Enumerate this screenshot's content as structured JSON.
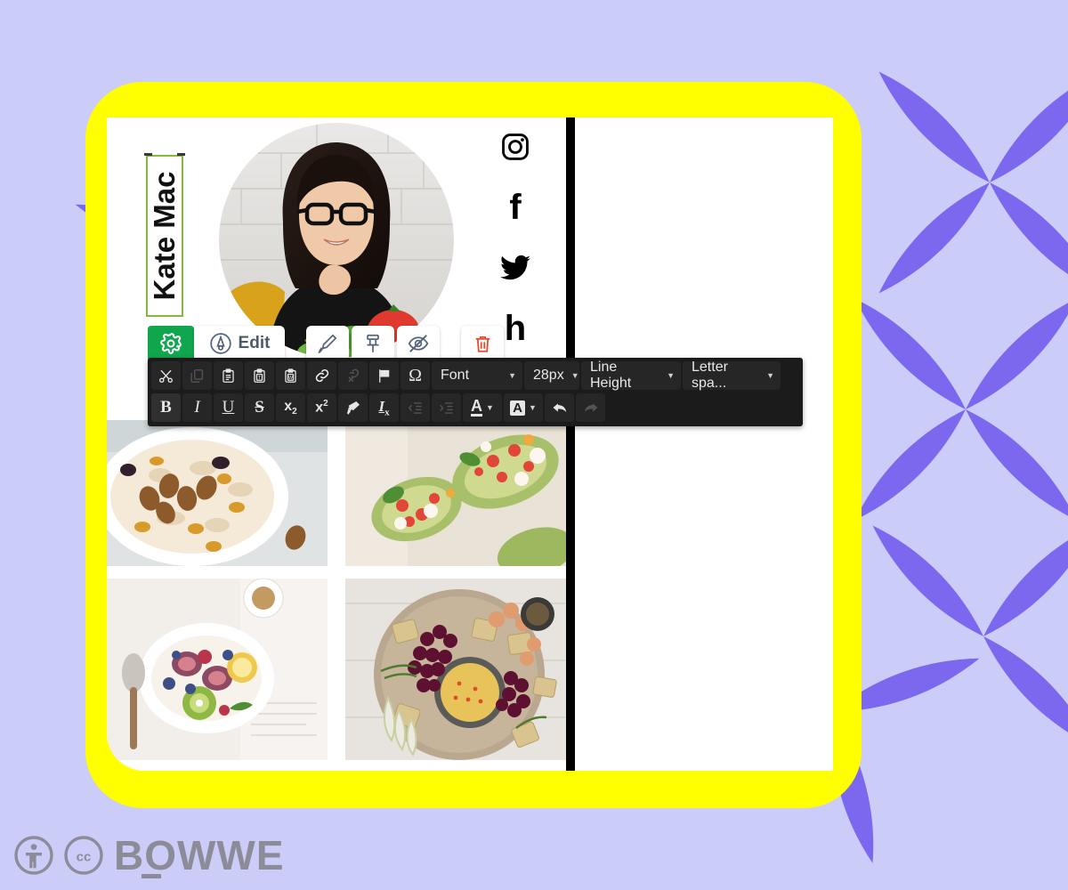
{
  "theme": {
    "page_bg": "#ccccf9",
    "petal_color": "#7b68ee",
    "frame_color": "#ffff00",
    "card_color": "#ffffff",
    "accent_green": "#10a64e",
    "selection_green": "#86b93a",
    "divider_black": "#000000",
    "toolbar_bg": "#1b1b1b",
    "delete_red": "#e8472c"
  },
  "site_preview": {
    "name_block": {
      "text": "Kate Mac",
      "orientation": "vertical-rotated",
      "selected": true
    },
    "portrait": {
      "alt": "woman-with-glasses-in-kitchen-portrait"
    },
    "socials": [
      {
        "name": "instagram",
        "glyph": "instagram-icon"
      },
      {
        "name": "facebook",
        "glyph": "f"
      },
      {
        "name": "twitter",
        "glyph": "twitter-bird-icon"
      },
      {
        "name": "houzz",
        "glyph": "h"
      }
    ],
    "gallery": [
      {
        "alt": "oatmeal-bowl-with-nuts-and-raisins"
      },
      {
        "alt": "stuffed-avocado-halves-with-tomato-and-feta"
      },
      {
        "alt": "yogurt-bowl-with-figs-kiwi-and-berries"
      },
      {
        "alt": "charcuterie-board-with-grapes-and-crackers"
      }
    ]
  },
  "control_bar": {
    "buttons": [
      {
        "name": "settings-gear-button",
        "icon": "gear-icon",
        "label": ""
      },
      {
        "name": "edit-button",
        "icon": "pen-circle-icon",
        "label": "Edit"
      },
      {
        "name": "style-brush-button",
        "icon": "paintbrush-icon",
        "label": ""
      },
      {
        "name": "pin-button",
        "icon": "pin-icon",
        "label": ""
      },
      {
        "name": "hide-button",
        "icon": "eye-off-icon",
        "label": ""
      },
      {
        "name": "delete-button",
        "icon": "trash-icon",
        "label": ""
      }
    ]
  },
  "rte_toolbar": {
    "row1": [
      {
        "name": "cut-button",
        "icon": "scissors-icon",
        "state": "enabled"
      },
      {
        "name": "copy-button",
        "icon": "copy-icon",
        "state": "disabled"
      },
      {
        "name": "paste-button",
        "icon": "clipboard-icon",
        "state": "enabled"
      },
      {
        "name": "paste-as-text-button",
        "icon": "clipboard-text-icon",
        "state": "enabled"
      },
      {
        "name": "paste-from-word-button",
        "icon": "clipboard-word-icon",
        "state": "enabled"
      },
      {
        "name": "insert-link-button",
        "icon": "link-icon",
        "state": "enabled"
      },
      {
        "name": "unlink-button",
        "icon": "unlink-icon",
        "state": "disabled"
      },
      {
        "name": "anchor-flag-button",
        "icon": "flag-icon",
        "state": "enabled"
      },
      {
        "name": "special-character-button",
        "icon": "omega-icon",
        "state": "enabled"
      }
    ],
    "dropdowns": [
      {
        "name": "font-family-select",
        "value": "Font"
      },
      {
        "name": "font-size-select",
        "value": "28px"
      },
      {
        "name": "line-height-select",
        "value": "Line Height"
      },
      {
        "name": "letter-spacing-select",
        "value": "Letter spa..."
      }
    ],
    "row2": [
      {
        "name": "bold-button",
        "icon": "bold-icon",
        "glyph": "B",
        "state": "active"
      },
      {
        "name": "italic-button",
        "icon": "italic-icon",
        "glyph": "I",
        "state": "enabled"
      },
      {
        "name": "underline-button",
        "icon": "underline-icon",
        "glyph": "U",
        "state": "enabled"
      },
      {
        "name": "strikethrough-button",
        "icon": "strikethrough-icon",
        "glyph": "S",
        "state": "enabled"
      },
      {
        "name": "subscript-button",
        "icon": "subscript-icon",
        "glyph": "x",
        "state": "enabled"
      },
      {
        "name": "superscript-button",
        "icon": "superscript-icon",
        "glyph": "x",
        "state": "enabled"
      },
      {
        "name": "copy-formatting-button",
        "icon": "paintbrush-icon",
        "state": "enabled"
      },
      {
        "name": "remove-format-button",
        "icon": "remove-format-icon",
        "glyph": "I",
        "state": "enabled"
      },
      {
        "name": "decrease-indent-button",
        "icon": "outdent-icon",
        "state": "disabled"
      },
      {
        "name": "increase-indent-button",
        "icon": "indent-icon",
        "state": "disabled"
      },
      {
        "name": "text-color-button",
        "icon": "text-color-icon",
        "glyph": "A",
        "state": "enabled"
      },
      {
        "name": "background-color-button",
        "icon": "background-color-icon",
        "glyph": "A",
        "state": "enabled"
      },
      {
        "name": "undo-button",
        "icon": "undo-arrow-icon",
        "state": "enabled"
      },
      {
        "name": "redo-button",
        "icon": "redo-arrow-icon",
        "state": "disabled"
      }
    ]
  },
  "footer": {
    "accessibility_icon": "accessibility-person-icon",
    "creative_commons_icon": "creative-commons-icon",
    "brand": "BOWWE"
  }
}
